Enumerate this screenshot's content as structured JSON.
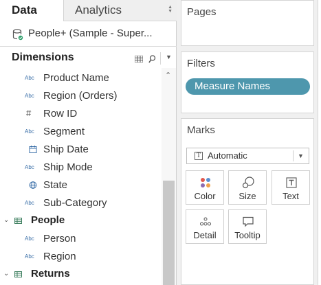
{
  "tabs": {
    "data_label": "Data",
    "analytics_label": "Analytics"
  },
  "datasource": {
    "name": "People+ (Sample - Super..."
  },
  "dimensions": {
    "title": "Dimensions",
    "items": [
      {
        "type": "Abc",
        "label": "Product Name"
      },
      {
        "type": "Abc",
        "label": "Region (Orders)"
      },
      {
        "type": "#",
        "label": "Row ID"
      },
      {
        "type": "Abc",
        "label": "Segment"
      },
      {
        "type": "date",
        "label": "Ship Date"
      },
      {
        "type": "Abc",
        "label": "Ship Mode"
      },
      {
        "type": "geo",
        "label": "State"
      },
      {
        "type": "Abc",
        "label": "Sub-Category"
      }
    ],
    "folders": [
      {
        "label": "People",
        "items": [
          {
            "type": "Abc",
            "label": "Person"
          },
          {
            "type": "Abc",
            "label": "Region"
          }
        ]
      },
      {
        "label": "Returns"
      }
    ]
  },
  "shelves": {
    "pages_title": "Pages",
    "filters_title": "Filters",
    "filter_pill": "Measure Names",
    "marks_title": "Marks",
    "mark_type": "Automatic",
    "mark_buttons": [
      "Color",
      "Size",
      "Text",
      "Detail",
      "Tooltip"
    ]
  },
  "colors": {
    "pill": "#4e97ad",
    "field_icon": "#3a6fa8"
  }
}
